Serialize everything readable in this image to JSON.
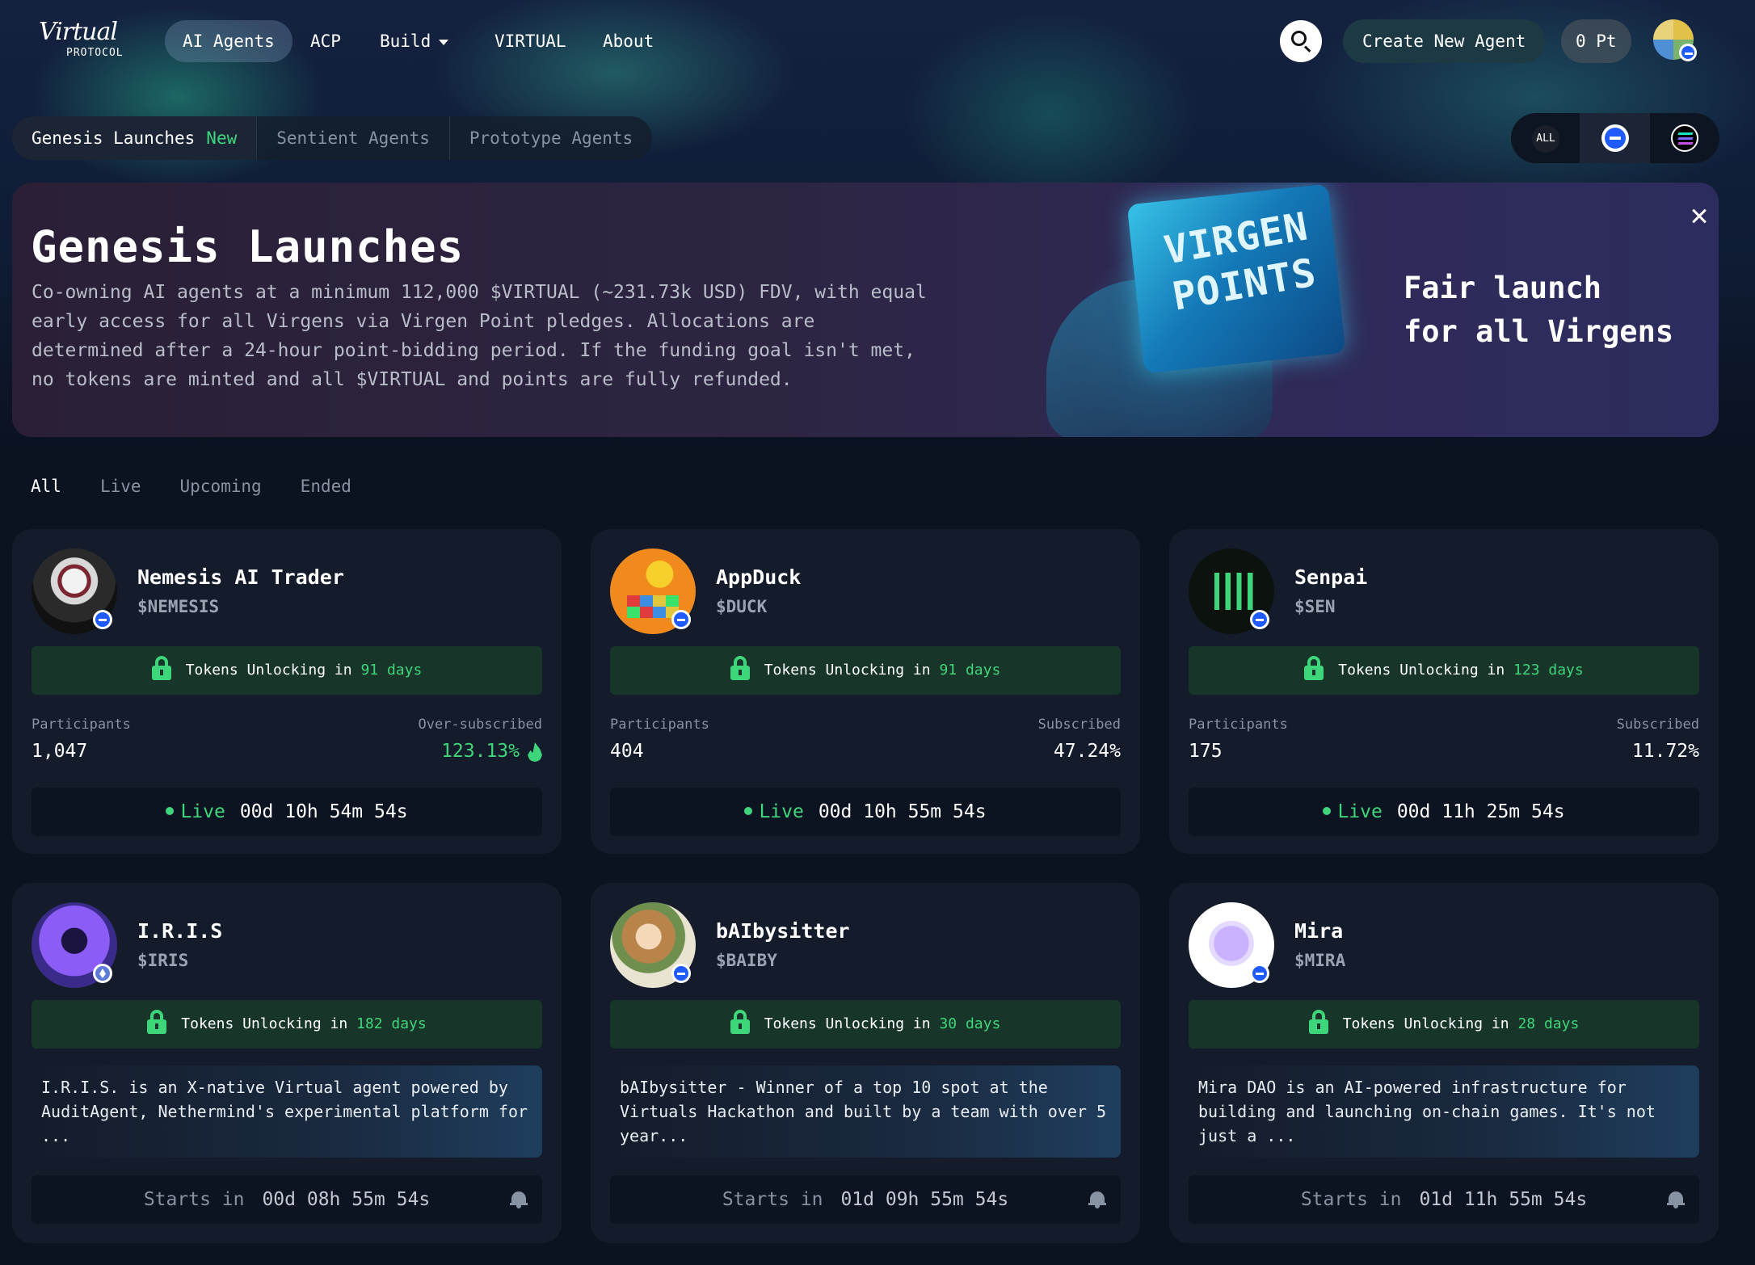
{
  "nav": {
    "logo_script": "Virtual",
    "logo_sub": "PROTOCOL",
    "items": [
      {
        "label": "AI Agents",
        "active": true
      },
      {
        "label": "ACP"
      },
      {
        "label": "Build",
        "has_dropdown": true
      },
      {
        "label": "VIRTUAL"
      },
      {
        "label": "About"
      }
    ],
    "create_label": "Create New Agent",
    "points": "0 Pt"
  },
  "subtabs": {
    "items": [
      {
        "label": "Genesis Launches",
        "badge": "New",
        "active": true
      },
      {
        "label": "Sentient Agents"
      },
      {
        "label": "Prototype Agents"
      }
    ],
    "chain_all": "ALL"
  },
  "banner": {
    "title": "Genesis Launches",
    "description": "Co-owning AI agents at a minimum 112,000 $VIRTUAL (~231.73k USD) FDV, with equal early access for all Virgens via Virgen Point pledges. Allocations are determined after a 24-hour point-bidding period. If the funding goal isn't met, no tokens are minted and all $VIRTUAL and points are fully refunded.",
    "art_text": "VIRGEN POINTS",
    "tagline_1": "Fair launch",
    "tagline_2": "for all Virgens"
  },
  "filters": [
    "All",
    "Live",
    "Upcoming",
    "Ended"
  ],
  "cards_live": [
    {
      "name": "Nemesis AI Trader",
      "ticker": "$NEMESIS",
      "unlock_prefix": "Tokens Unlocking in",
      "unlock_days": "91 days",
      "participants_label": "Participants",
      "participants": "1,047",
      "sub_label": "Over-subscribed",
      "sub_value": "123.13%",
      "status": "Live",
      "countdown": "00d 10h 54m 54s",
      "chain": "base"
    },
    {
      "name": "AppDuck",
      "ticker": "$DUCK",
      "unlock_prefix": "Tokens Unlocking in",
      "unlock_days": "91 days",
      "participants_label": "Participants",
      "participants": "404",
      "sub_label": "Subscribed",
      "sub_value": "47.24%",
      "status": "Live",
      "countdown": "00d 10h 55m 54s",
      "chain": "base"
    },
    {
      "name": "Senpai",
      "ticker": "$SEN",
      "unlock_prefix": "Tokens Unlocking in",
      "unlock_days": "123 days",
      "participants_label": "Participants",
      "participants": "175",
      "sub_label": "Subscribed",
      "sub_value": "11.72%",
      "status": "Live",
      "countdown": "00d 11h 25m 54s",
      "chain": "base"
    }
  ],
  "cards_upcoming": [
    {
      "name": "I.R.I.S",
      "ticker": "$IRIS",
      "unlock_prefix": "Tokens Unlocking in",
      "unlock_days": "182 days",
      "description": "I.R.I.S. is an X-native Virtual agent powered by AuditAgent, Nethermind's experimental platform for ...",
      "starts_label": "Starts in",
      "countdown": "00d 08h 55m 54s",
      "chain": "ethereum"
    },
    {
      "name": "bAIbysitter",
      "ticker": "$BAIBY",
      "unlock_prefix": "Tokens Unlocking in",
      "unlock_days": "30 days",
      "description": "bAIbysitter - Winner of a top 10 spot at the Virtuals Hackathon and built by a team with over 5 year...",
      "starts_label": "Starts in",
      "countdown": "01d 09h 55m 54s",
      "chain": "base"
    },
    {
      "name": "Mira",
      "ticker": "$MIRA",
      "unlock_prefix": "Tokens Unlocking in",
      "unlock_days": "28 days",
      "description": "Mira DAO is an AI-powered infrastructure for building and launching on-chain games. It's not just a ...",
      "starts_label": "Starts in",
      "countdown": "01d 11h 55m 54s",
      "chain": "base"
    }
  ],
  "colors": {
    "accent_green": "#3ed67a",
    "base_blue": "#1f5bff",
    "background": "#0b1220",
    "card": "#141c2b"
  }
}
